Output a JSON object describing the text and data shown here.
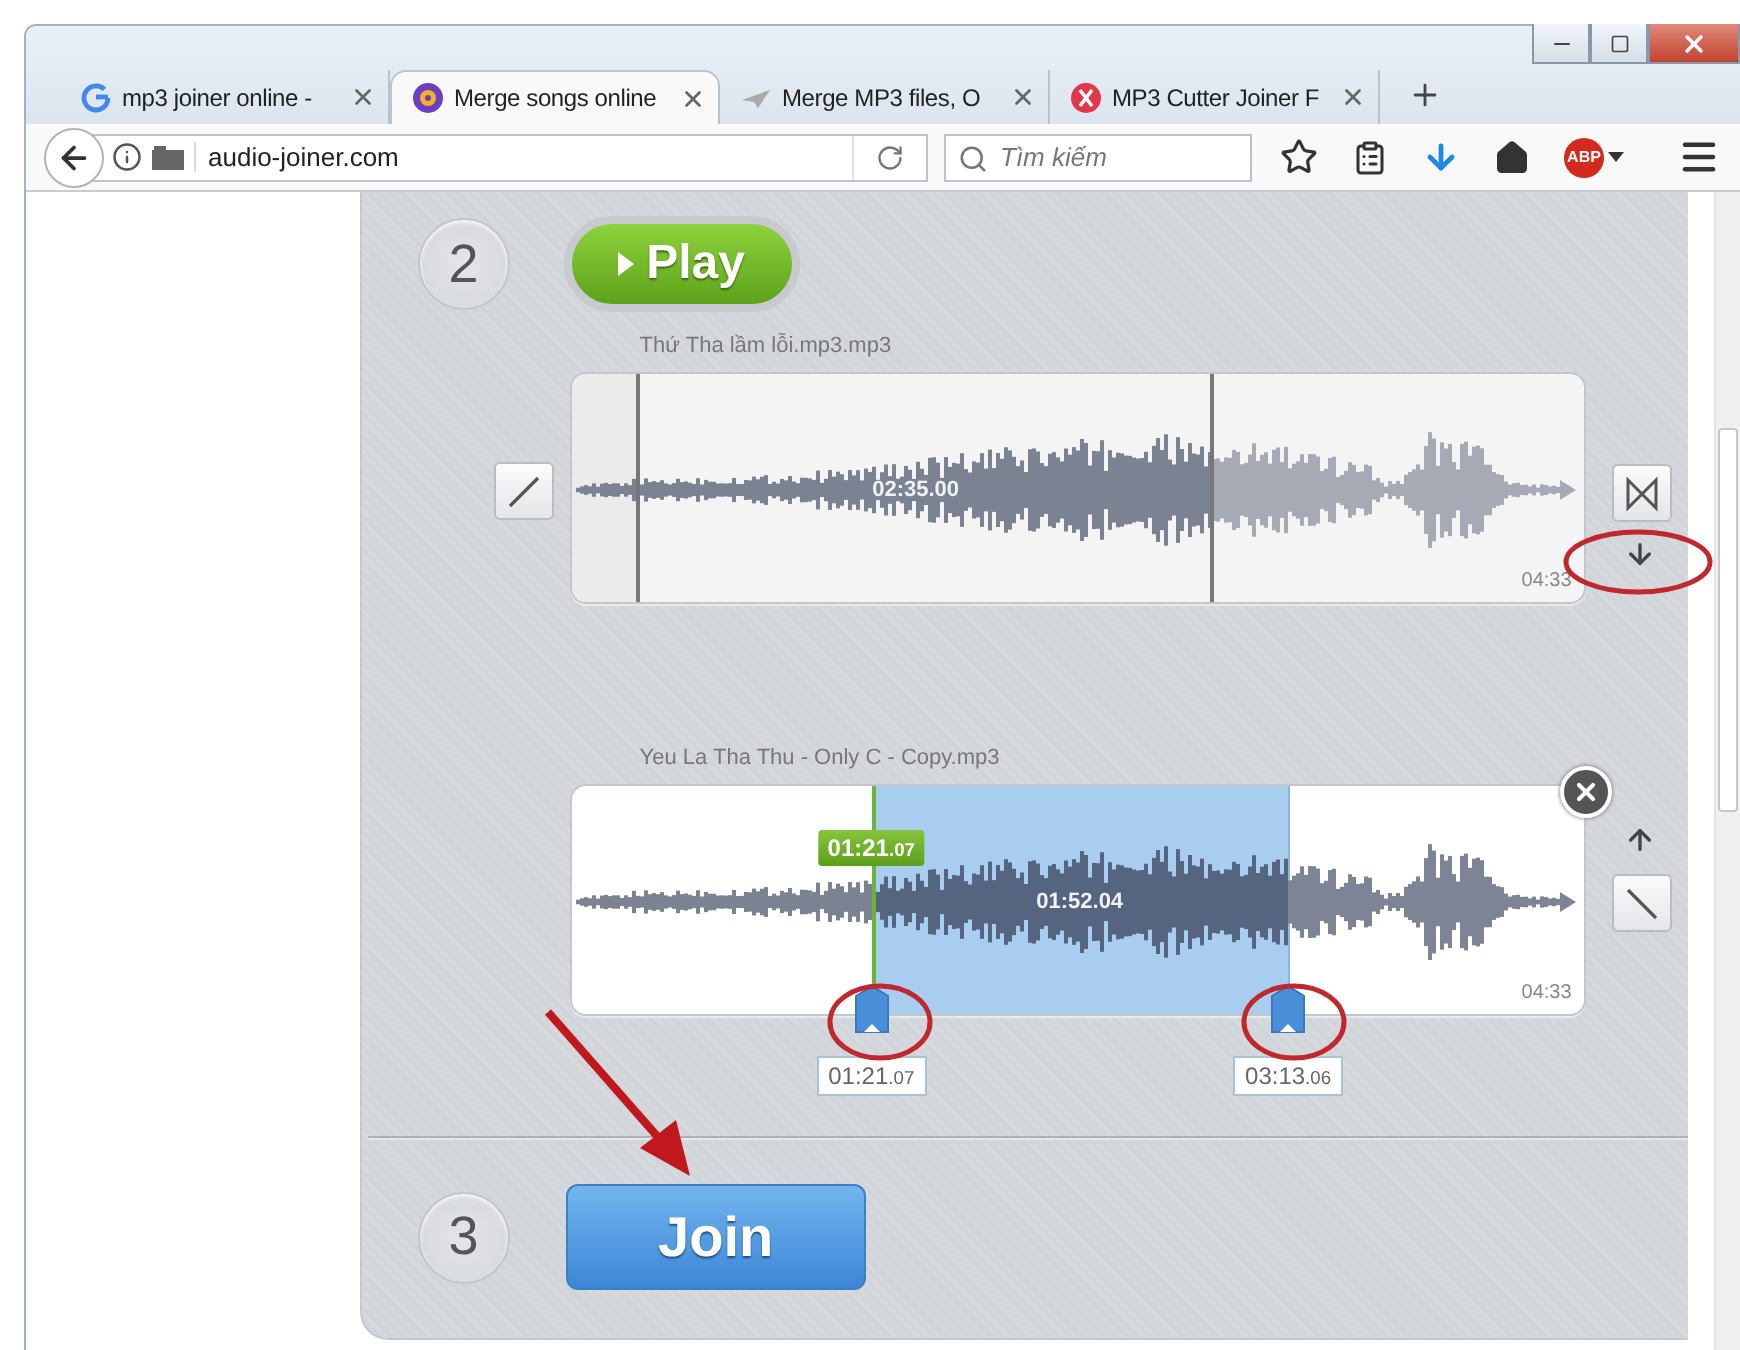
{
  "tabs": [
    {
      "label": "mp3 joiner online -",
      "selected": false,
      "kind": "google"
    },
    {
      "label": "Merge songs online",
      "selected": true,
      "kind": "disc"
    },
    {
      "label": "Merge MP3 files, O",
      "selected": false,
      "kind": "plane"
    },
    {
      "label": "MP3 Cutter Joiner F",
      "selected": false,
      "kind": "scissors"
    }
  ],
  "address": "audio-joiner.com",
  "search": {
    "placeholder": "Tìm kiếm"
  },
  "adblock_badge": "ABP",
  "step_play": {
    "number": "2",
    "button": "Play"
  },
  "tracks": [
    {
      "filename": "Thứ Tha lầm lỗi.mp3.mp3",
      "kind": "plain",
      "center_time": "02:35.00",
      "end_time": "04:33"
    },
    {
      "filename": "Yeu La Tha Thu - Only C - Copy.mp3",
      "kind": "trimmed",
      "center_time": "01:52.04",
      "end_time": "04:33",
      "start_tooltip": {
        "main": "01:21",
        "fraction": ".07"
      },
      "start": {
        "main": "01:21",
        "fraction": ".07"
      },
      "end": {
        "main": "03:13",
        "fraction": ".06"
      }
    }
  ],
  "step_join": {
    "number": "3",
    "button": "Join"
  }
}
